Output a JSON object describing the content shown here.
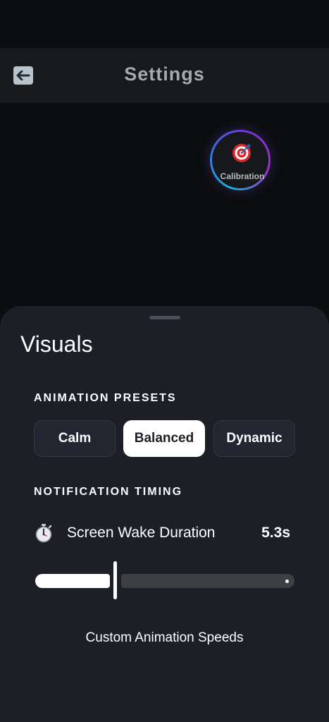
{
  "header": {
    "title": "Settings",
    "back_icon": "back-arrow-icon"
  },
  "calibration": {
    "label": "Calibration",
    "icon": "target-icon"
  },
  "sheet": {
    "title": "Visuals",
    "animation_presets": {
      "label": "ANIMATION PRESETS",
      "options": [
        "Calm",
        "Balanced",
        "Dynamic"
      ],
      "selected": "Balanced"
    },
    "notification_timing": {
      "label": "NOTIFICATION TIMING",
      "screen_wake": {
        "label": "Screen Wake Duration",
        "value": "5.3s",
        "icon": "stopwatch-icon",
        "slider_fraction": 0.31
      }
    },
    "custom_speeds_label": "Custom Animation Speeds"
  },
  "colors": {
    "background": "#0c0d0f",
    "header": "#17191d",
    "sheet": "#1c1f26",
    "accent_selected": "#ffffff"
  }
}
